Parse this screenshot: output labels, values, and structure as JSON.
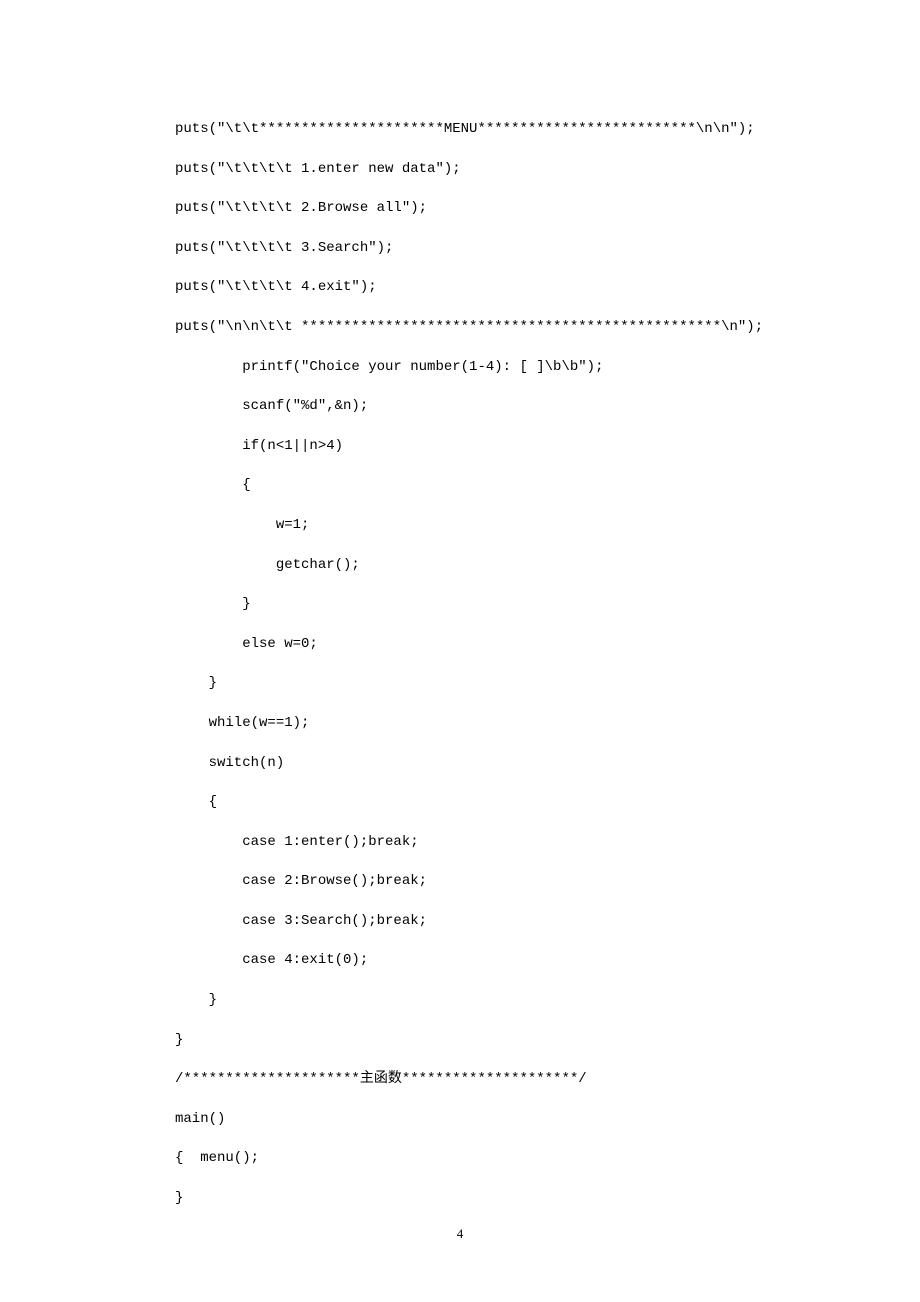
{
  "lines": [
    "puts(\"\\t\\t**********************MENU**************************\\n\\n\");",
    "puts(\"\\t\\t\\t\\t 1.enter new data\");",
    "puts(\"\\t\\t\\t\\t 2.Browse all\");",
    "puts(\"\\t\\t\\t\\t 3.Search\");",
    "puts(\"\\t\\t\\t\\t 4.exit\");",
    "puts(\"\\n\\n\\t\\t **************************************************\\n\");",
    "        printf(\"Choice your number(1-4): [ ]\\b\\b\");",
    "        scanf(\"%d\",&n);",
    "        if(n<1||n>4)",
    "        {",
    "            w=1;",
    "            getchar();",
    "        }",
    "        else w=0;",
    "    }",
    "    while(w==1);",
    "    switch(n)",
    "    {",
    "        case 1:enter();break;",
    "        case 2:Browse();break;",
    "        case 3:Search();break;",
    "        case 4:exit(0);",
    "    }",
    "}",
    "/*********************主函数*********************/",
    "main()",
    "{  menu();",
    "}"
  ],
  "pageNumber": "4"
}
